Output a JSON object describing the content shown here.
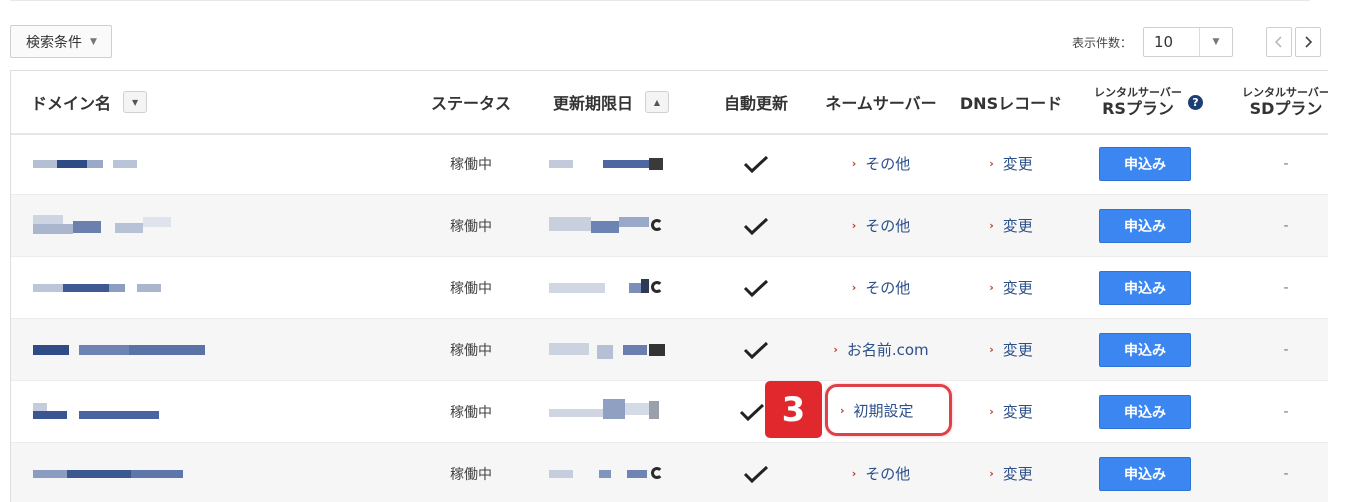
{
  "toolbar": {
    "search_conditions": "検索条件",
    "display_count_label": "表示件数：",
    "display_count_value": "10"
  },
  "table": {
    "headers": {
      "domain": "ドメイン名",
      "status": "ステータス",
      "expiry": "更新期限日",
      "auto_renew": "自動更新",
      "nameserver": "ネームサーバー",
      "dns": "DNSレコード",
      "rs_top": "レンタルサーバー",
      "rs_bottom": "RSプラン",
      "sd_top": "レンタルサーバー",
      "sd_bottom": "SDプラン"
    },
    "rows": [
      {
        "status": "稼働中",
        "nameserver": "その他",
        "dns": "変更",
        "rs": "申込み",
        "sd": "-"
      },
      {
        "status": "稼働中",
        "nameserver": "その他",
        "dns": "変更",
        "rs": "申込み",
        "sd": "-"
      },
      {
        "status": "稼働中",
        "nameserver": "その他",
        "dns": "変更",
        "rs": "申込み",
        "sd": "-"
      },
      {
        "status": "稼働中",
        "nameserver": "お名前.com",
        "dns": "変更",
        "rs": "申込み",
        "sd": "-"
      },
      {
        "status": "稼働中",
        "nameserver": "初期設定",
        "dns": "変更",
        "rs": "申込み",
        "sd": "-"
      },
      {
        "status": "稼働中",
        "nameserver": "その他",
        "dns": "変更",
        "rs": "申込み",
        "sd": "-"
      }
    ]
  },
  "annotation": {
    "step": "3",
    "color": "#e0282d"
  },
  "colors": {
    "link": "#2b4f8a",
    "chevron": "#c0392b",
    "button": "#3b86f0"
  }
}
